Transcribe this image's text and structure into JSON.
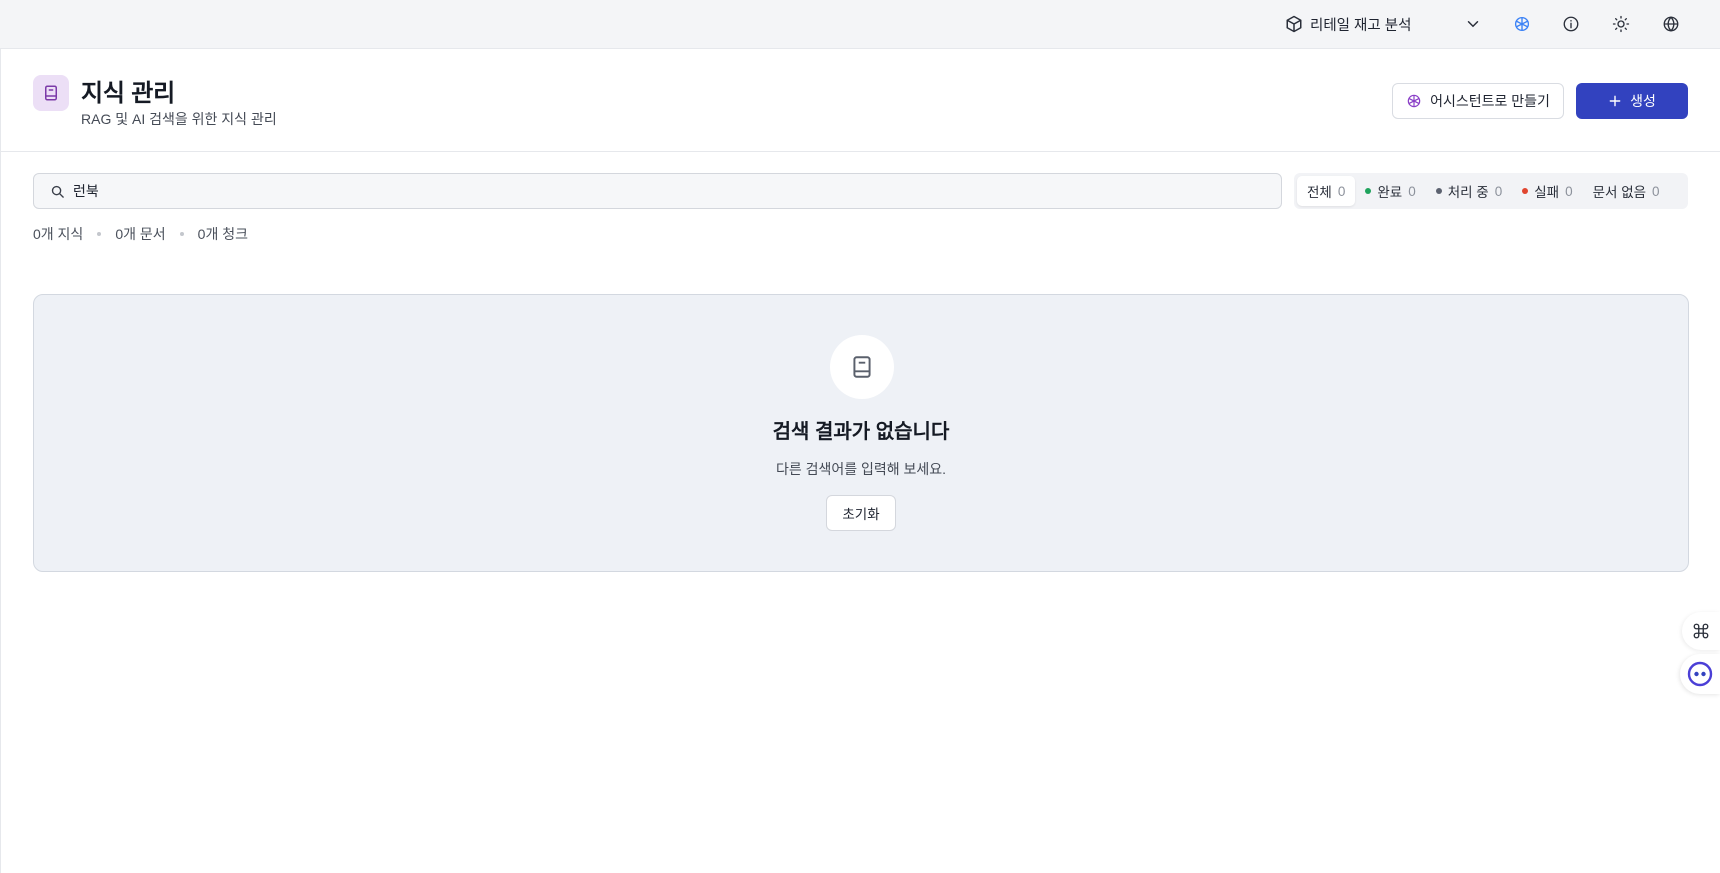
{
  "topbar": {
    "project_name": "리테일 재고 분석",
    "icons": [
      "cube-icon",
      "chevron-down-icon",
      "ai-assistant-icon",
      "info-icon",
      "sun-icon",
      "globe-icon"
    ]
  },
  "header": {
    "title": "지식 관리",
    "subtitle": "RAG 및 AI 검색을 위한 지식 관리",
    "assistant_button": "어시스턴트로 만들기",
    "create_button": "생성"
  },
  "search": {
    "value": "런북",
    "placeholder": ""
  },
  "filters": [
    {
      "label": "전체",
      "count": "0",
      "dot": ""
    },
    {
      "label": "완료",
      "count": "0",
      "dot": "#1fa35c"
    },
    {
      "label": "처리 중",
      "count": "0",
      "dot": "#5c6270"
    },
    {
      "label": "실패",
      "count": "0",
      "dot": "#e0452f"
    },
    {
      "label": "문서 없음",
      "count": "0",
      "dot": ""
    }
  ],
  "stats": {
    "knowledge": "0개 지식",
    "documents": "0개 문서",
    "chunks": "0개 청크"
  },
  "empty_state": {
    "title": "검색 결과가 없습니다",
    "description": "다른 검색어를 입력해 보세요.",
    "reset_button": "초기화"
  },
  "colors": {
    "primary": "#3242bf",
    "page_icon_bg": "#ecdff6",
    "page_icon_fg": "#7b3aa8",
    "empty_bg": "#eef1f6"
  }
}
